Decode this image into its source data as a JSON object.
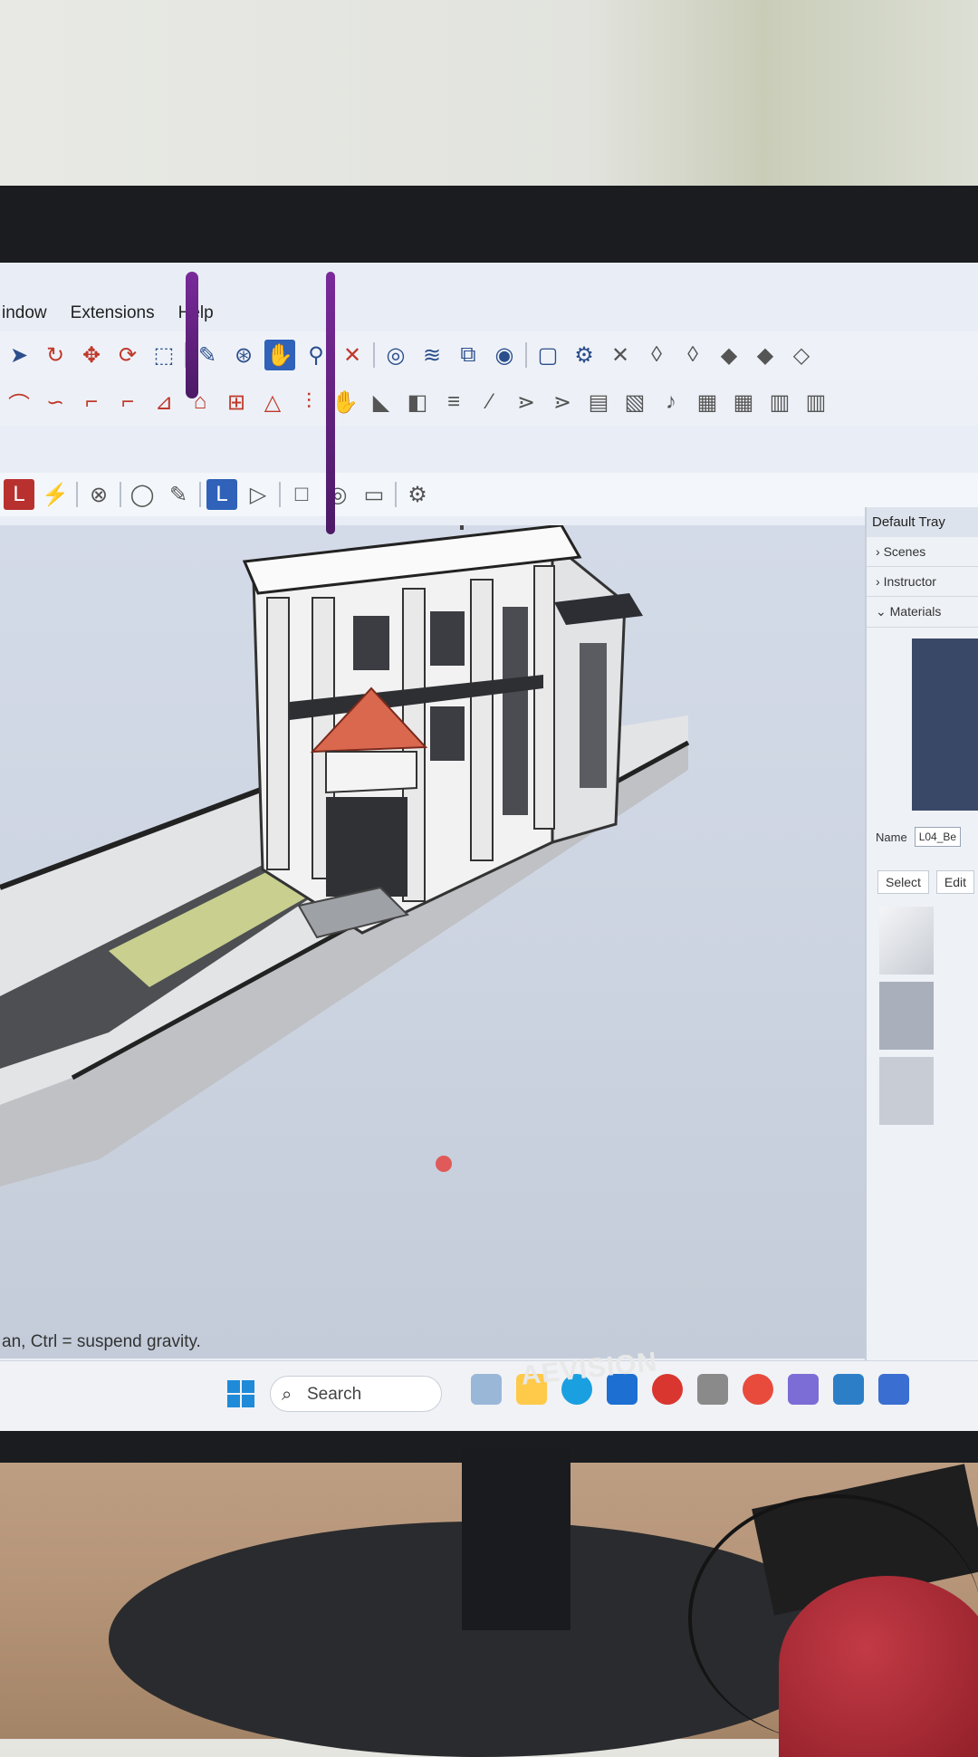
{
  "menu": {
    "items": [
      "indow",
      "Extensions",
      "Help"
    ]
  },
  "tray": {
    "title": "Default Tray",
    "sections": [
      "Scenes",
      "Instructor",
      "Materials"
    ],
    "name_label": "Name",
    "name_value": "L04_Be",
    "tabs": [
      "Select",
      "Edit"
    ]
  },
  "status": {
    "text": "an, Ctrl = suspend gravity."
  },
  "taskbar": {
    "search_label": "Search"
  },
  "monitor": {
    "brand": "AEVISION"
  },
  "colors": {
    "accent": "#2f62b8",
    "roof": "#d9684f",
    "lawn": "#c9cf8e"
  }
}
